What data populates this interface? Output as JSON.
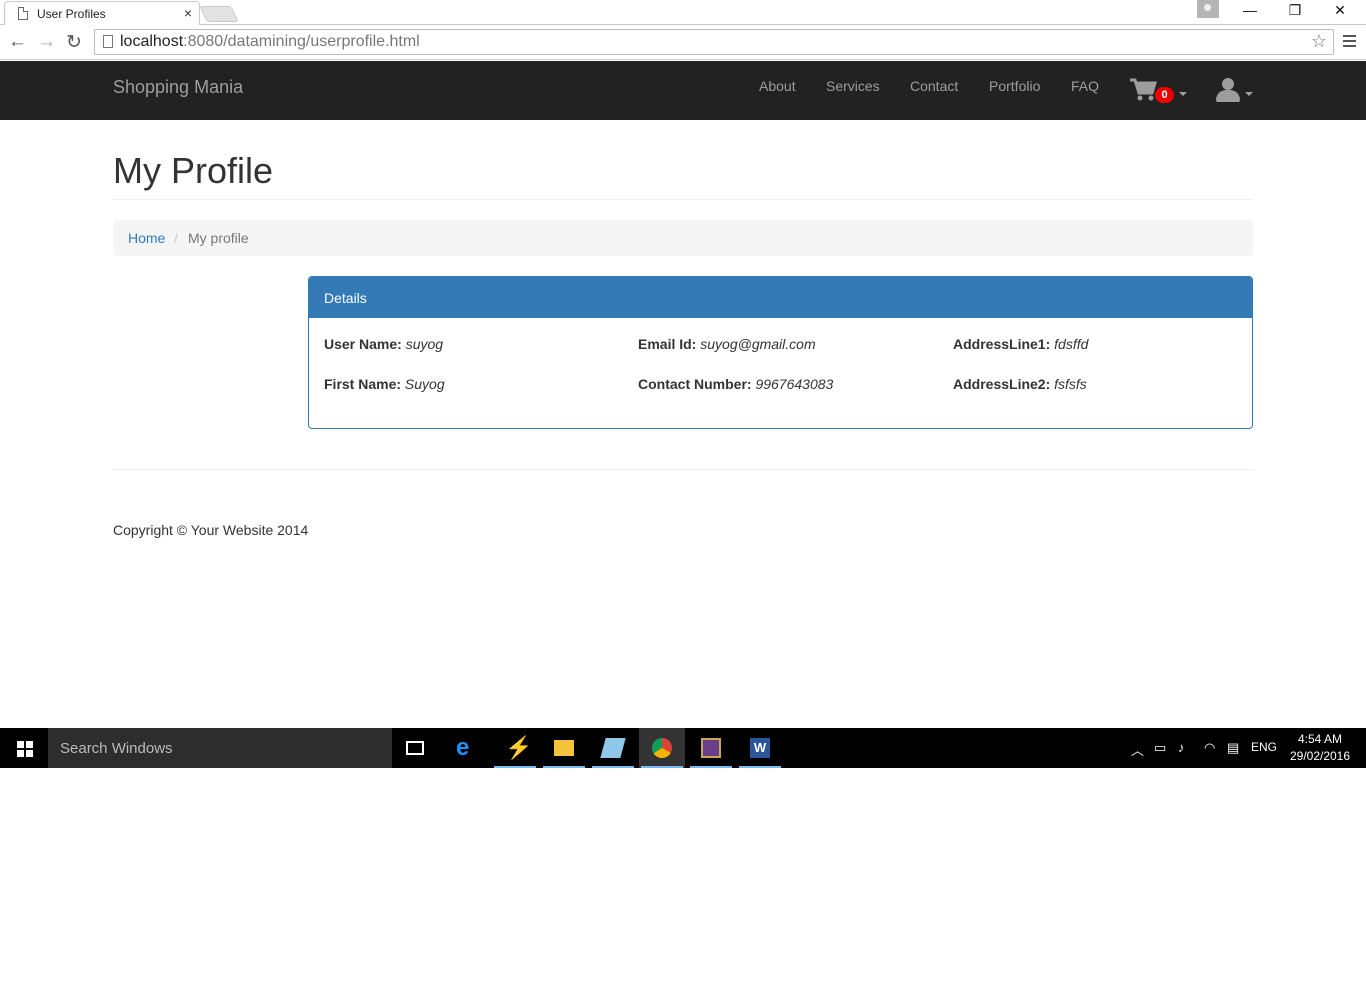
{
  "browser": {
    "tab_title": "User Profiles",
    "tab_close": "×",
    "url_host": "localhost",
    "url_path": ":8080/datamining/userprofile.html",
    "back": "←",
    "forward": "→",
    "reload": "↻",
    "star": "☆",
    "minimize": "—",
    "restore": "❐",
    "close": "✕"
  },
  "navbar": {
    "brand": "Shopping Mania",
    "links": [
      "About",
      "Services",
      "Contact",
      "Portfolio",
      "FAQ"
    ],
    "cart_count": "0",
    "cart_icon": "cart-icon",
    "user_icon": "user-icon"
  },
  "page": {
    "title": "My Profile",
    "breadcrumb": {
      "home": "Home",
      "separator": "/",
      "active": "My profile"
    }
  },
  "panel": {
    "heading": "Details",
    "fields": [
      {
        "label": "User Name:",
        "value": "suyog"
      },
      {
        "label": "Email Id:",
        "value": "suyog@gmail.com"
      },
      {
        "label": "AddressLine1:",
        "value": "fdsffd"
      },
      {
        "label": "First Name:",
        "value": "Suyog"
      },
      {
        "label": "Contact Number:",
        "value": "9967643083"
      },
      {
        "label": "AddressLine2:",
        "value": "fsfsfs"
      }
    ]
  },
  "footer": {
    "copyright": "Copyright © Your Website 2014"
  },
  "taskbar": {
    "search_placeholder": "Search Windows",
    "language": "ENG",
    "time": "4:54 AM",
    "date": "29/02/2016"
  },
  "colors": {
    "primary": "#337ab7",
    "navbar": "#222222",
    "badge": "#ee0000"
  }
}
